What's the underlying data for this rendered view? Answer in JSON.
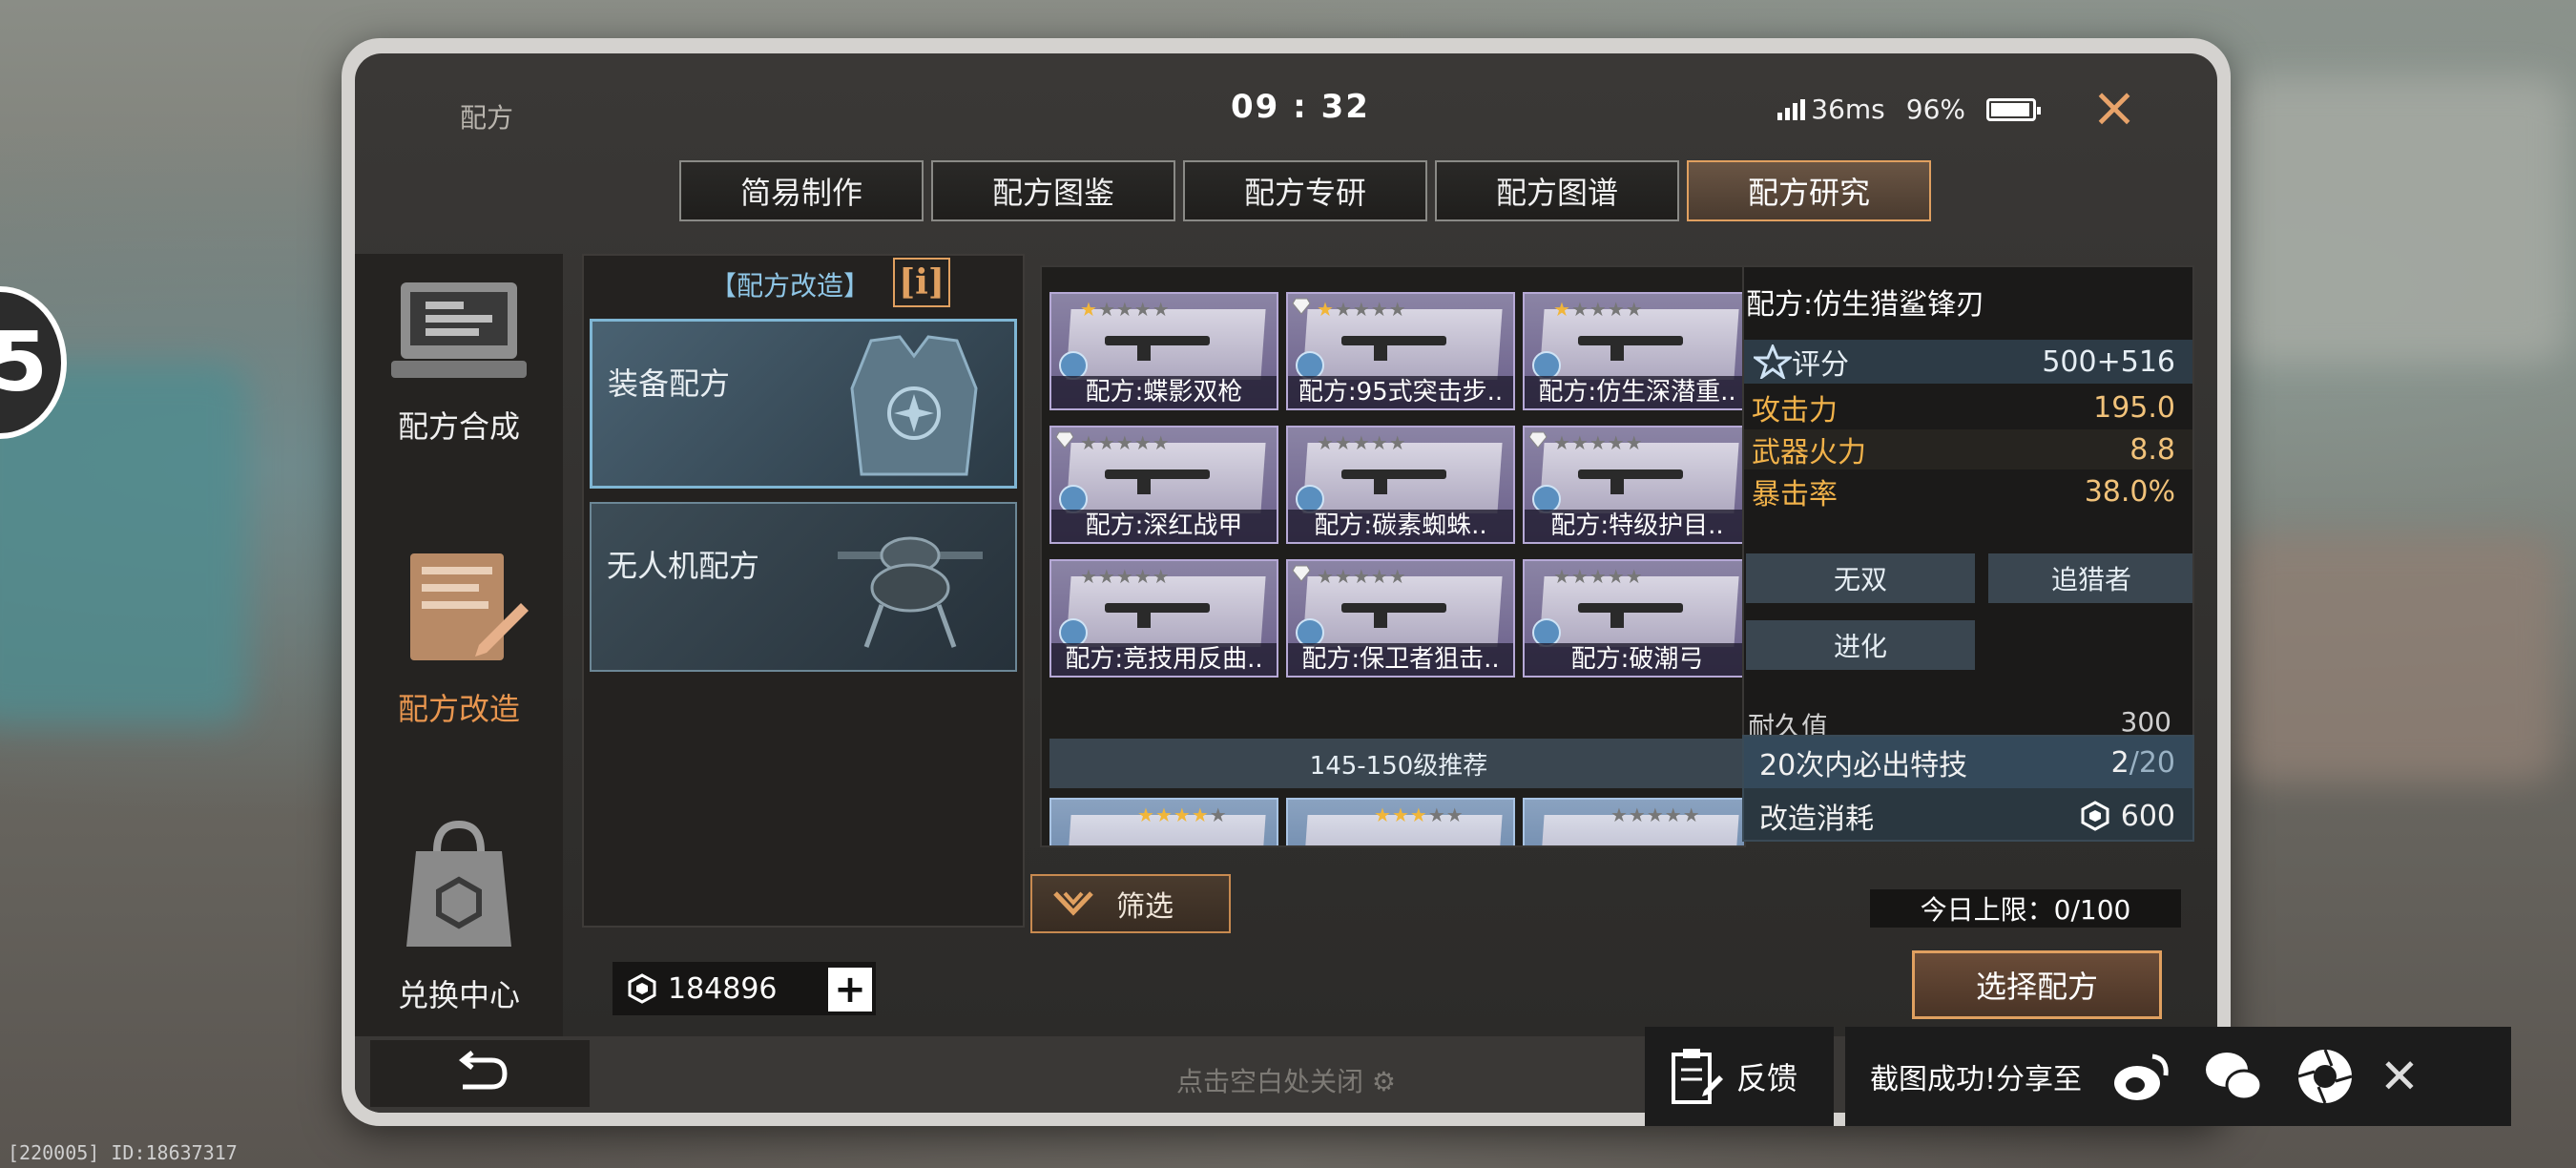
{
  "top": {
    "title": "配方",
    "time": "09 : 32",
    "ping": "36ms",
    "battery": "96%",
    "battery_level": 0.96
  },
  "tabs": [
    "简易制作",
    "配方图鉴",
    "配方专研",
    "配方图谱",
    "配方研究"
  ],
  "active_tab": "配方研究",
  "sidebar": [
    {
      "label": "配方合成",
      "active": false,
      "icon": "terminal-icon"
    },
    {
      "label": "配方改造",
      "active": true,
      "icon": "blueprint-pencil-icon"
    },
    {
      "label": "兑换中心",
      "active": false,
      "icon": "exchange-bag-icon"
    }
  ],
  "category": {
    "header": "【配方改造】",
    "info_label": "i",
    "cards": [
      {
        "label": "装备配方",
        "active": true,
        "icon": "armor-vest-icon"
      },
      {
        "label": "无人机配方",
        "active": false,
        "icon": "drone-icon"
      }
    ]
  },
  "currency": {
    "amount": "184896",
    "plus": "+",
    "icon": "hex-coin-icon"
  },
  "recipes": [
    {
      "name": "配方:蝶影双枪",
      "stars": 1,
      "gem": false
    },
    {
      "name": "配方:95式突击步..",
      "stars": 1,
      "gem": true
    },
    {
      "name": "配方:仿生深潜重..",
      "stars": 1,
      "gem": false
    },
    {
      "name": "配方:深红战甲",
      "stars": 0,
      "gem": true
    },
    {
      "name": "配方:碳素蜘蛛..",
      "stars": 0,
      "gem": false
    },
    {
      "name": "配方:特级护目..",
      "stars": 0,
      "gem": true
    },
    {
      "name": "配方:竞技用反曲..",
      "stars": 0,
      "gem": false
    },
    {
      "name": "配方:保卫者狙击..",
      "stars": 0,
      "gem": true
    },
    {
      "name": "配方:破潮弓",
      "stars": 0,
      "gem": false
    }
  ],
  "section_label": "145-150级推荐",
  "recipes2": [
    {
      "stars": 4
    },
    {
      "stars": 3
    },
    {
      "stars": 0
    }
  ],
  "filter_label": "筛选",
  "detail": {
    "title": "配方:仿生猎鲨锋刃",
    "score_label": "评分",
    "score_value": "500+516",
    "stats": [
      {
        "label": "攻击力",
        "value": "195.0"
      },
      {
        "label": "武器火力",
        "value": "8.8"
      },
      {
        "label": "暴击率",
        "value": "38.0%"
      }
    ],
    "skills": [
      "无双",
      "追猎者",
      "进化"
    ],
    "durability_label": "耐久值",
    "durability_value": "300"
  },
  "guarantee": {
    "label": "20次内必出特技",
    "current": "2",
    "total": "/20"
  },
  "cost": {
    "label": "改造消耗",
    "value": "600"
  },
  "daily_limit": "今日上限：0/100",
  "choose_button": "选择配方",
  "bottom_hint": "点击空白处关闭",
  "feedback_label": "反馈",
  "share": {
    "text": "截图成功!分享至",
    "icons": [
      "weibo-icon",
      "wechat-icon",
      "camera-shutter-icon"
    ]
  },
  "corner_status": "[220005] ID:18637317",
  "edge_badge": "5"
}
